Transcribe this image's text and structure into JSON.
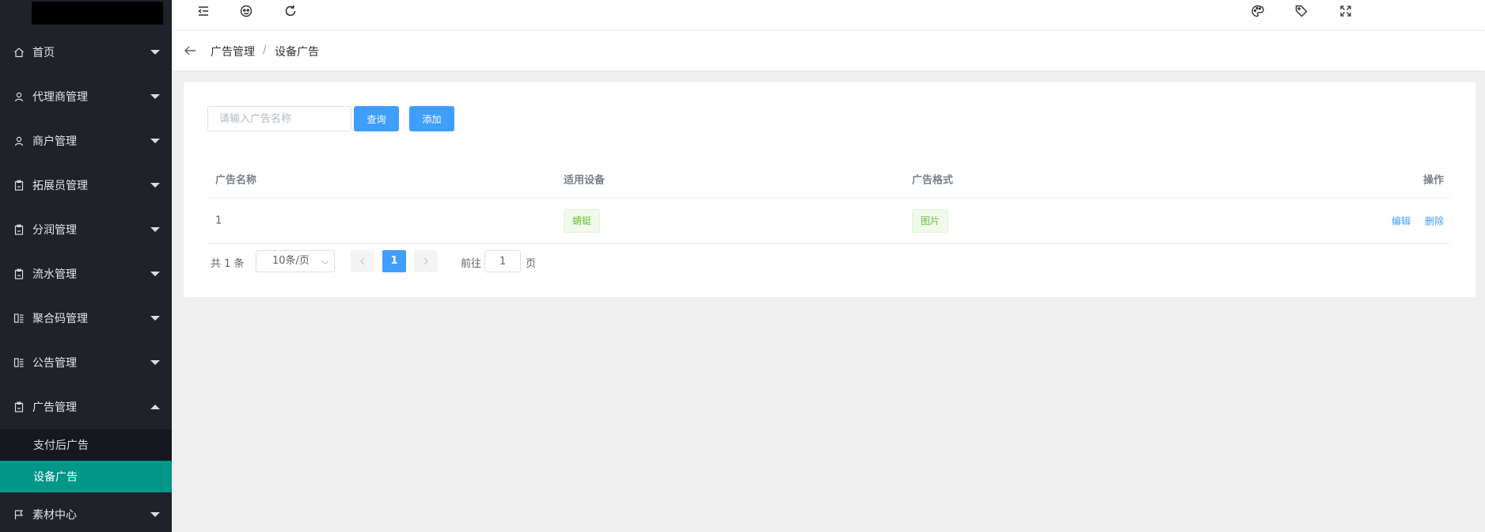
{
  "sidebar": {
    "items": [
      {
        "label": "首页",
        "icon": "home-icon"
      },
      {
        "label": "代理商管理",
        "icon": "user-icon"
      },
      {
        "label": "商户管理",
        "icon": "user-icon"
      },
      {
        "label": "拓展员管理",
        "icon": "clipboard-icon"
      },
      {
        "label": "分润管理",
        "icon": "clipboard-icon"
      },
      {
        "label": "流水管理",
        "icon": "clipboard-icon"
      },
      {
        "label": "聚合码管理",
        "icon": "columns-icon"
      },
      {
        "label": "公告管理",
        "icon": "columns-icon"
      },
      {
        "label": "广告管理",
        "icon": "clipboard-icon",
        "open": true
      },
      {
        "label": "素材中心",
        "icon": "flag-icon"
      }
    ],
    "submenu": [
      {
        "label": "支付后广告"
      },
      {
        "label": "设备广告",
        "active": true
      }
    ],
    "active_color": "#009688",
    "bg_color": "#20222a"
  },
  "header": {
    "icons": [
      "menu-fold-icon",
      "globe-icon",
      "refresh-icon",
      "palette-icon",
      "tag-icon",
      "fullscreen-icon"
    ]
  },
  "breadcrumb": {
    "items": [
      "广告管理",
      "设备广告"
    ],
    "separator": "/"
  },
  "search": {
    "placeholder": "请输入广告名称",
    "value": "",
    "query_label": "查询",
    "add_label": "添加"
  },
  "table": {
    "columns": [
      "广告名称",
      "适用设备",
      "广告格式",
      "操作"
    ],
    "rows": [
      {
        "name": "1",
        "device": "蜻蜓",
        "format": "图片",
        "actions": [
          "编辑",
          "删除"
        ]
      }
    ]
  },
  "pagination": {
    "total_text": "共 1 条",
    "page_size": "10条/页",
    "current_page": "1",
    "goto_label": "前往",
    "goto_value": "1",
    "page_suffix": "页"
  },
  "colors": {
    "primary": "#409eff",
    "tag_green": "#67c23a"
  }
}
